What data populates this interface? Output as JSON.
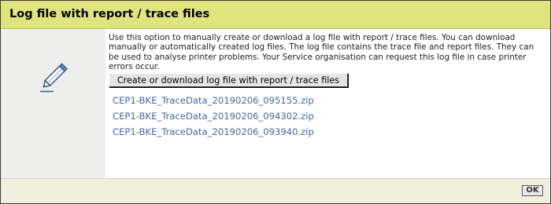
{
  "dialog": {
    "title": "Log file with report / trace files",
    "icon": "pencil-icon",
    "description": "Use this option to manually create or download a log file with report / trace files. You can download manually or automatically created log files. The log file contains the trace file and report files. They can be used to analyse printer problems. Your Service organisation can request this log file in case printer errors occur.",
    "create_button_label": "Create or download log file with report / trace files",
    "files": [
      {
        "name": "CEP1-BKE_TraceData_20190206_095155.zip"
      },
      {
        "name": "CEP1-BKE_TraceData_20190206_094302.zip"
      },
      {
        "name": "CEP1-BKE_TraceData_20190206_093940.zip"
      }
    ],
    "ok_label": "OK"
  },
  "colors": {
    "title_bar": "#e0e47c",
    "icon_panel": "#eeeeed",
    "footer": "#f0eedc",
    "link": "#3f6ba0"
  }
}
